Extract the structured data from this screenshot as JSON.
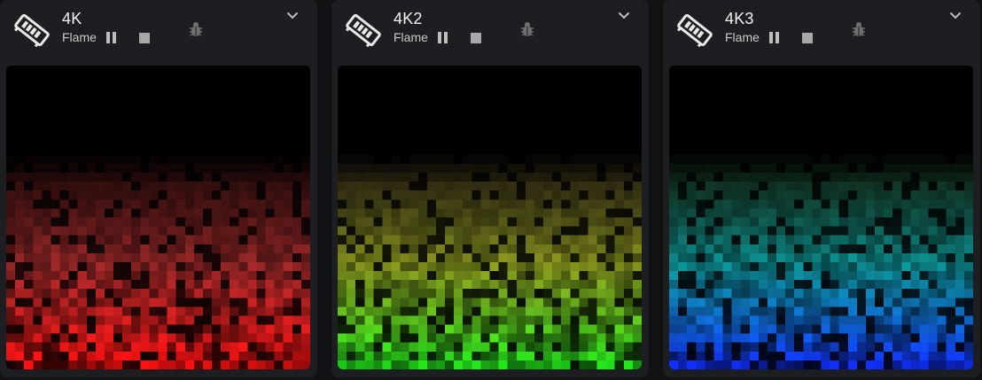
{
  "devices": [
    {
      "name": "4K",
      "effect": "Flame",
      "palette": {
        "bottom": "#ff1010",
        "mid": "#e03a3a",
        "top": "#5a1a1a"
      },
      "seed": 11
    },
    {
      "name": "4K2",
      "effect": "Flame",
      "palette": {
        "bottom": "#22e81a",
        "mid": "#c8d82a",
        "top": "#5a4a2a"
      },
      "seed": 23
    },
    {
      "name": "4K3",
      "effect": "Flame",
      "palette": {
        "bottom": "#1030ff",
        "mid": "#12d8d8",
        "top": "#2a5a2a"
      },
      "seed": 37
    }
  ],
  "icons": {
    "device": "ram-stick-icon",
    "pause": "pause-icon",
    "stop": "stop-icon",
    "debug": "bug-icon",
    "expand": "chevron-down-icon"
  },
  "colors": {
    "background": "#111214",
    "card": "#1d1e21",
    "preview_bg": "#000000",
    "icon_grey": "#bdbdbd"
  }
}
